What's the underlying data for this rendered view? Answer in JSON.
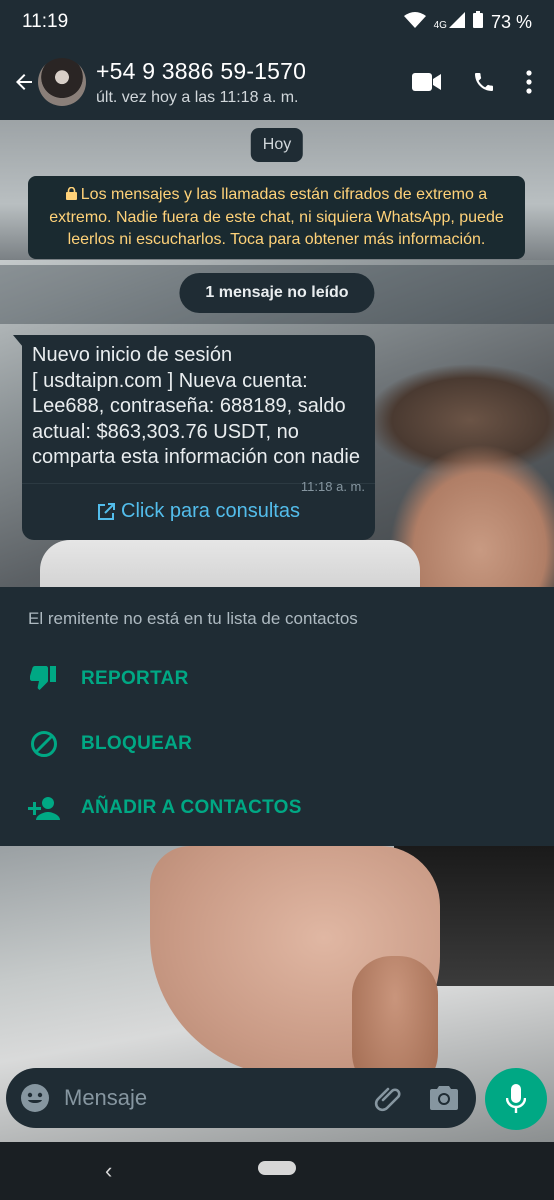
{
  "status": {
    "time": "11:19",
    "network": "4G",
    "battery": "73 %"
  },
  "header": {
    "contact_name": "+54 9 3886 59-1570",
    "last_seen": "últ. vez hoy a las 11:18 a. m."
  },
  "chat": {
    "date_chip": "Hoy",
    "encryption_notice": "Los mensajes y las llamadas están cifrados de extremo a extremo. Nadie fuera de este chat, ni siquiera WhatsApp, puede leerlos ni escucharlos. Toca para obtener más información.",
    "unread_label": "1 mensaje no leído",
    "message": {
      "text": "Nuevo inicio de sesión\n[ usdtaipn.com ] Nueva cuenta: Lee688, contraseña: 688189, saldo actual: $863,303.76 USDT, no comparta esta información con nadie",
      "time": "11:18 a. m.",
      "link_label": "Click para consultas"
    }
  },
  "unknown_sender": {
    "notice": "El remitente no está en tu lista de contactos",
    "actions": [
      {
        "label": "REPORTAR",
        "icon": "thumb-down-icon"
      },
      {
        "label": "BLOQUEAR",
        "icon": "block-icon"
      },
      {
        "label": "AÑADIR A CONTACTOS",
        "icon": "add-person-icon"
      }
    ]
  },
  "composer": {
    "placeholder": "Mensaje"
  },
  "colors": {
    "accent": "#00a884",
    "link": "#53bdeb",
    "notice_text": "#ffd279",
    "panel": "#1f2c34"
  }
}
